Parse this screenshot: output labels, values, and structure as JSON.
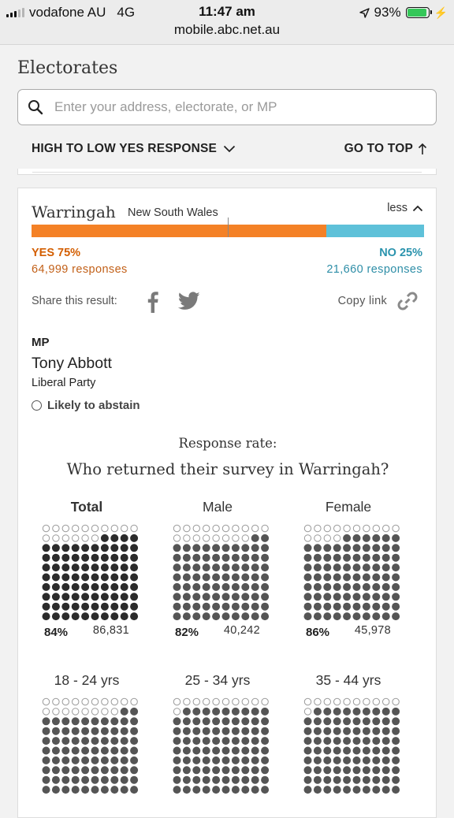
{
  "status_bar": {
    "carrier": "vodafone AU",
    "network": "4G",
    "time": "11:47 am",
    "url": "mobile.abc.net.au",
    "battery": "93%",
    "battery_level": 0.93
  },
  "panel": {
    "title": "Electorates",
    "search_placeholder": "Enter your address, electorate, or MP",
    "sort_label": "HIGH TO LOW YES RESPONSE",
    "go_top_label": "GO TO TOP"
  },
  "electorate": {
    "name": "Warringah",
    "state": "New South Wales",
    "toggle_label": "less",
    "yes_fraction": 0.75,
    "yes_label": "YES 75%",
    "yes_responses": "64,999 responses",
    "no_label": "NO 25%",
    "no_responses": "21,660 responses",
    "share_label": "Share this result:",
    "copy_link_label": "Copy link",
    "mp_heading": "MP",
    "mp_name": "Tony Abbott",
    "mp_party": "Liberal Party",
    "mp_stance": "Likely to abstain",
    "response_rate_label": "Response rate:",
    "response_rate_title": "Who returned their survey in Warringah?",
    "groups": [
      {
        "label": "Total",
        "pct": "84%",
        "count": "86,831",
        "filled": 84,
        "color": "#2b2b2b",
        "bold": true
      },
      {
        "label": "Male",
        "pct": "82%",
        "count": "40,242",
        "filled": 82,
        "color": "#555555",
        "bold": false
      },
      {
        "label": "Female",
        "pct": "86%",
        "count": "45,978",
        "filled": 86,
        "color": "#555555",
        "bold": false
      },
      {
        "label": "18 - 24 yrs",
        "pct": "",
        "count": "",
        "filled": 82,
        "color": "#555555",
        "bold": false
      },
      {
        "label": "25 - 34 yrs",
        "pct": "",
        "count": "",
        "filled": 89,
        "color": "#555555",
        "bold": false
      },
      {
        "label": "35 - 44 yrs",
        "pct": "",
        "count": "",
        "filled": 89,
        "color": "#555555",
        "bold": false
      }
    ]
  },
  "colors": {
    "yes": "#f48126",
    "no": "#5ec1d9",
    "yes_text": "#d35e00",
    "no_text": "#2a93ad"
  }
}
